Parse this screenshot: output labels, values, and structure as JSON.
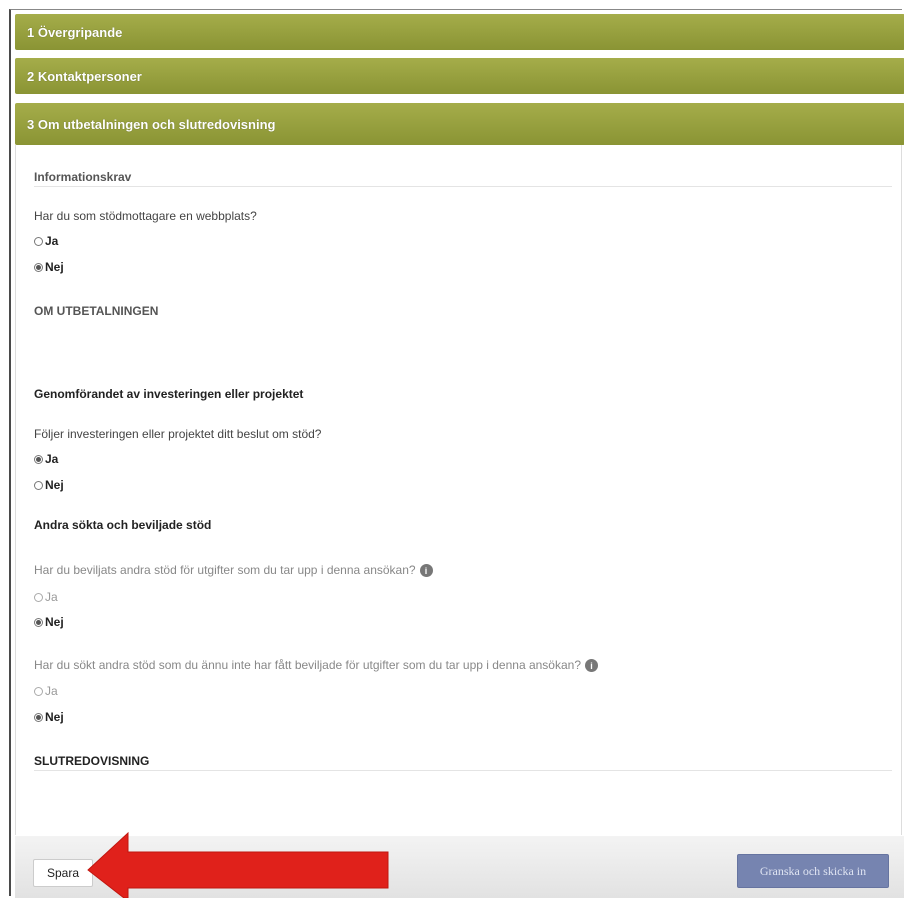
{
  "accordion": {
    "section1": "1 Övergripande",
    "section2": "2 Kontaktpersoner",
    "section3": "3 Om utbetalningen och slutredovisning"
  },
  "content": {
    "info_heading": "Informationskrav",
    "q_website": "Har du som stödmottagare en webbplats?",
    "q_website_yes": "Ja",
    "q_website_no": "Nej",
    "om_utbetalningen": "OM UTBETALNINGEN",
    "genomforandet_heading": "Genomförandet av investeringen eller projektet",
    "q_follows": "Följer investeringen eller projektet ditt beslut om stöd?",
    "q_follows_yes": "Ja",
    "q_follows_no": "Nej",
    "andra_stod_heading": "Andra sökta och beviljade stöd",
    "q_granted": "Har du beviljats andra stöd för utgifter som du tar upp i denna ansökan?",
    "q_granted_yes": "Ja",
    "q_granted_no": "Nej",
    "q_applied": "Har du sökt andra stöd som du ännu inte har fått beviljade för utgifter som du tar upp i denna ansökan?",
    "q_applied_yes": "Ja",
    "q_applied_no": "Nej",
    "slutredovisning": "SLUTREDOVISNING",
    "info_icon_glyph": "i"
  },
  "footer": {
    "save_label": "Spara",
    "submit_label": "Granska och skicka in"
  },
  "colors": {
    "accordion": "#9aa23f",
    "submit_button": "#7684b0",
    "arrow": "#e0211b"
  },
  "icons": {
    "info": "info-icon",
    "arrow": "red-arrow-annotation"
  }
}
